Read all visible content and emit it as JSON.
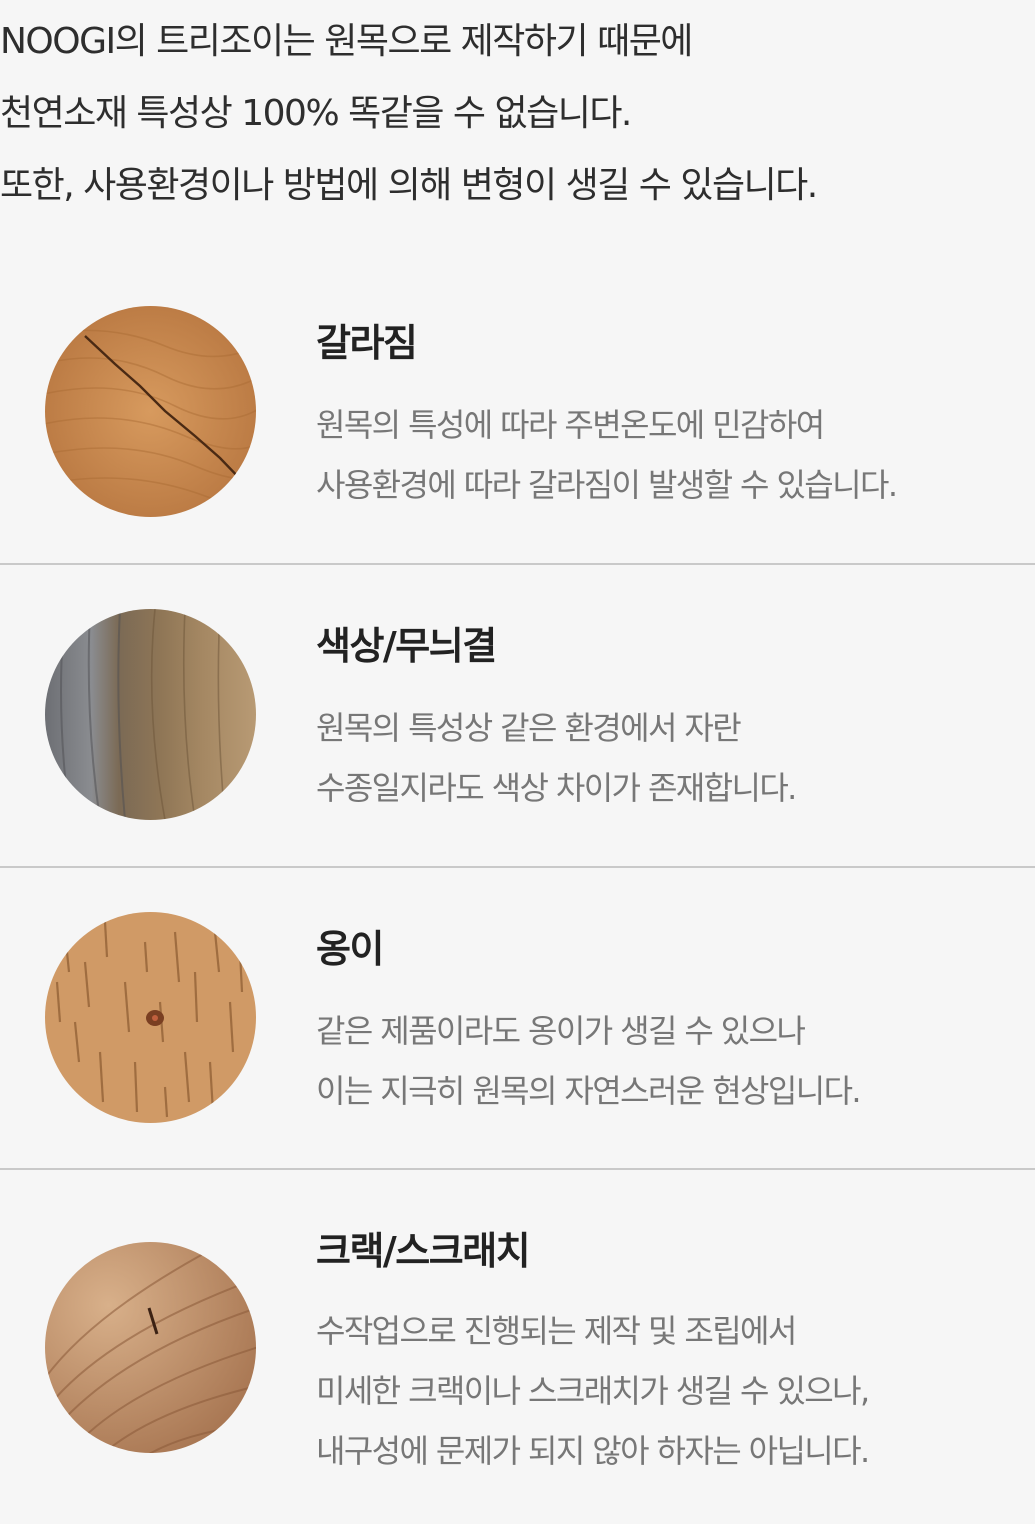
{
  "intro": {
    "lines": [
      "NOOGI의 트리조이는 원목으로 제작하기 때문에",
      "천연소재 특성상 100% 똑같을 수 없습니다.",
      "또한, 사용환경이나 방법에 의해 변형이 생길 수 있습니다."
    ]
  },
  "sections": [
    {
      "title": "갈라짐",
      "image_icon": "wood-crack-photo",
      "lines": [
        "원목의 특성에 따라 주변온도에 민감하여",
        "사용환경에 따라 갈라짐이 발생할 수 있습니다."
      ]
    },
    {
      "title": "색상/무늬결",
      "image_icon": "wood-color-grain-photo",
      "lines": [
        "원목의 특성상 같은 환경에서 자란",
        "수종일지라도 색상 차이가 존재합니다."
      ]
    },
    {
      "title": "옹이",
      "image_icon": "wood-knot-photo",
      "lines": [
        "같은 제품이라도 옹이가 생길 수 있으나",
        "이는 지극히 원목의 자연스러운 현상입니다."
      ]
    },
    {
      "title": "크랙/스크래치",
      "image_icon": "wood-scratch-photo",
      "lines": [
        "수작업으로 진행되는 제작 및 조립에서",
        "미세한 크랙이나 스크래치가 생길 수 있으나,",
        "내구성에 문제가 되지 않아 하자는 아닙니다."
      ]
    }
  ],
  "colors": {
    "background": "#f6f6f6",
    "divider": "#c9c9c9",
    "title": "#222222",
    "body": "#777777"
  }
}
